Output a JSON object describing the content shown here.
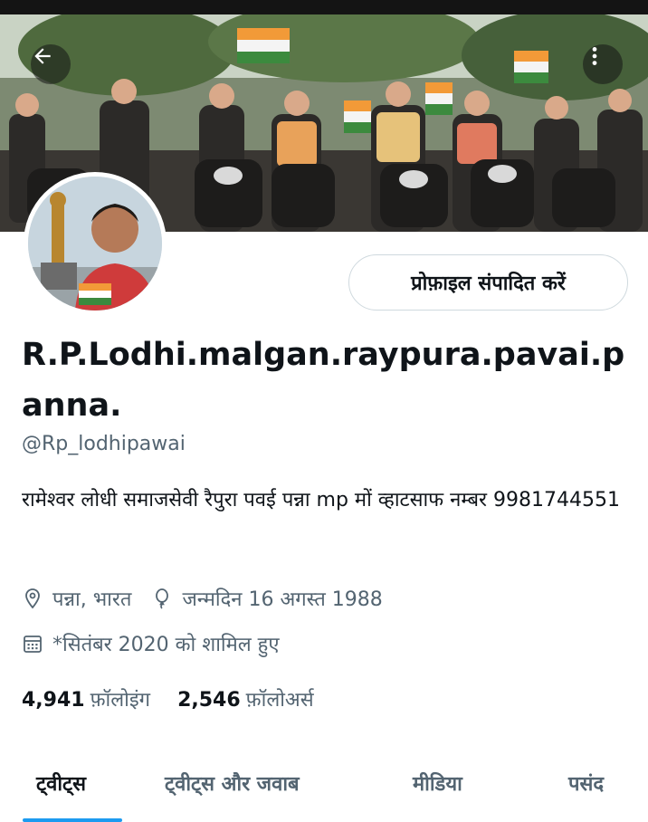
{
  "header": {
    "back_icon": "arrow-left-icon",
    "more_icon": "more-vertical-icon"
  },
  "profile": {
    "display_name": "R.P.Lodhi.malgan.raypura.pavai.panna.",
    "handle": "@Rp_lodhipawai",
    "edit_button_label": "प्रोफ़ाइल संपादित करें",
    "bio": "रामेश्वर लोधी समाजसेवी रैपुरा पवई पन्ना mp मों व्हाटसाफ नम्बर 9981744551",
    "location": "पन्ना, भारत",
    "birthday": "जन्मदिन 16 अगस्त 1988",
    "joined": "*सितंबर 2020 को शामिल हुए"
  },
  "stats": {
    "following_count": "4,941",
    "following_label": "फ़ॉलोइंग",
    "followers_count": "2,546",
    "followers_label": "फ़ॉलोअर्स"
  },
  "tabs": [
    {
      "label": "ट्वीट्स",
      "active": true
    },
    {
      "label": "ट्वीट्स और जवाब",
      "active": false
    },
    {
      "label": "मीडिया",
      "active": false
    },
    {
      "label": "पसंद",
      "active": false
    }
  ],
  "colors": {
    "accent": "#1d9bf0",
    "secondary_text": "#536471",
    "primary_text": "#0f1419",
    "border": "#cfd9de"
  }
}
